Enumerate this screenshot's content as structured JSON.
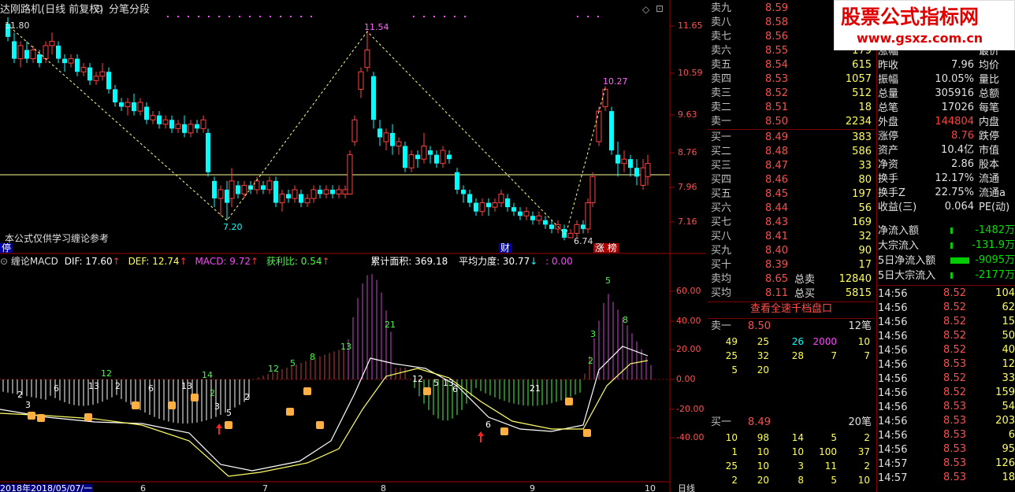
{
  "header": {
    "title": "达刚路机(日线 前复权)",
    "period_label": "分笔分段",
    "note": "本公式仅供学习缠论参考",
    "stop_tag": "停",
    "event_cai": "财",
    "event_zhangbang": "涨 榜"
  },
  "price_axis": [
    "11.65",
    "10.59",
    "9.63",
    "8.76",
    "7.96",
    "7.16"
  ],
  "price_marks": {
    "p1": "11.80",
    "p2": "11.54",
    "p3": "7.20",
    "p4": "10.27",
    "p5": "6.74"
  },
  "indicator": {
    "name": "缠论MACD",
    "dif_label": "DIF: 17.60",
    "def_label": "DEF: 12.74",
    "macd_label": "MACD: 9.72",
    "profit_label": "获利比: 0.54",
    "area_label": "累计面积: 369.18",
    "power_label": "平均力度: 30.77",
    "zero_label": ": 0.00",
    "axis": [
      "60.00",
      "40.00",
      "20.00",
      "0.00",
      "-20.00",
      "-40.00"
    ],
    "counts": [
      "2",
      "3",
      "6",
      "13",
      "12",
      "2",
      "6",
      "13",
      "14",
      "2",
      "3",
      "5",
      "2",
      "12",
      "5",
      "8",
      "13",
      "21",
      "12",
      "5",
      "6",
      "21",
      "6",
      "13",
      "3",
      "2",
      "5",
      "8"
    ]
  },
  "bottom_axis": {
    "date_label": "2018年2018/05/07/一",
    "months": [
      "6",
      "7",
      "8",
      "9",
      "10"
    ],
    "right_label": "日线"
  },
  "order_book": {
    "sells": [
      {
        "label": "卖九",
        "price": "8.59",
        "vol": ""
      },
      {
        "label": "卖八",
        "price": "8.58",
        "vol": ""
      },
      {
        "label": "卖七",
        "price": "8.56",
        "vol": ""
      },
      {
        "label": "卖六",
        "price": "8.55",
        "vol": "179"
      },
      {
        "label": "卖五",
        "price": "8.54",
        "vol": "615"
      },
      {
        "label": "卖四",
        "price": "8.53",
        "vol": "1057"
      },
      {
        "label": "卖三",
        "price": "8.52",
        "vol": "512"
      },
      {
        "label": "卖二",
        "price": "8.51",
        "vol": "18"
      },
      {
        "label": "卖一",
        "price": "8.50",
        "vol": "2234"
      }
    ],
    "buys": [
      {
        "label": "买一",
        "price": "8.49",
        "vol": "383"
      },
      {
        "label": "买二",
        "price": "8.48",
        "vol": "586"
      },
      {
        "label": "买三",
        "price": "8.47",
        "vol": "33"
      },
      {
        "label": "买四",
        "price": "8.46",
        "vol": "80"
      },
      {
        "label": "买五",
        "price": "8.45",
        "vol": "197"
      },
      {
        "label": "买六",
        "price": "8.44",
        "vol": "56"
      },
      {
        "label": "买七",
        "price": "8.43",
        "vol": "169"
      },
      {
        "label": "买八",
        "price": "8.41",
        "vol": "32"
      },
      {
        "label": "买九",
        "price": "8.40",
        "vol": "90"
      },
      {
        "label": "买十",
        "price": "8.39",
        "vol": "17"
      }
    ],
    "avg_sell": {
      "label": "卖均",
      "price": "8.65",
      "tag": "总卖",
      "vol": "12840"
    },
    "avg_buy": {
      "label": "买均",
      "price": "8.11",
      "tag": "总买",
      "vol": "5815"
    },
    "full_depth_button": "查看全速千档盘口"
  },
  "quote": [
    {
      "l": "涨幅",
      "v": "",
      "r": "最价"
    },
    {
      "l": "昨收",
      "v": "7.96",
      "r": "均价"
    },
    {
      "l": "振幅",
      "v": "10.05%",
      "r": "量比"
    },
    {
      "l": "总量",
      "v": "305916",
      "r": "总额"
    },
    {
      "l": "总笔",
      "v": "17026",
      "r": "每笔"
    },
    {
      "l": "外盘",
      "v": "144804",
      "r": "内盘"
    },
    {
      "l": "涨停",
      "v": "8.76",
      "r": "跌停"
    },
    {
      "l": "资产",
      "v": "10.4亿",
      "r": "市值"
    },
    {
      "l": "净资",
      "v": "2.86",
      "r": "股本"
    },
    {
      "l": "换手",
      "v": "12.17%",
      "r": "流通"
    },
    {
      "l": "换手Z",
      "v": "22.75%",
      "r": "流通a"
    },
    {
      "l": "收益(三)",
      "v": "0.064",
      "r": "PE(动)"
    }
  ],
  "flows": [
    {
      "l": "净流入额",
      "v": "-1482万"
    },
    {
      "l": "大宗流入",
      "v": "-131.9万"
    },
    {
      "l": "5日净流入额",
      "v": "-9095万"
    },
    {
      "l": "5日大宗流入",
      "v": "-2177万"
    }
  ],
  "queue": {
    "sell_label": "卖一",
    "sell_price": "8.50",
    "sell_count": "12笔",
    "sell_rows": [
      [
        "49",
        "25",
        "26",
        "2000",
        "10"
      ],
      [
        "25",
        "32",
        "28",
        "7",
        "7"
      ],
      [
        "5",
        "20",
        "",
        "",
        ""
      ]
    ],
    "buy_label": "买一",
    "buy_price": "8.49",
    "buy_count": "20笔",
    "buy_rows": [
      [
        "10",
        "98",
        "14",
        "5",
        "2"
      ],
      [
        "1",
        "10",
        "10",
        "100",
        "37"
      ],
      [
        "25",
        "10",
        "3",
        "11",
        "2"
      ],
      [
        "2",
        "20",
        "8",
        "5",
        "10"
      ]
    ]
  },
  "ticks": [
    {
      "t": "14:56",
      "p": "8.52",
      "v": "104"
    },
    {
      "t": "14:56",
      "p": "8.52",
      "v": "62"
    },
    {
      "t": "14:56",
      "p": "8.52",
      "v": "15"
    },
    {
      "t": "14:56",
      "p": "8.52",
      "v": "50"
    },
    {
      "t": "14:56",
      "p": "8.52",
      "v": "40"
    },
    {
      "t": "14:56",
      "p": "8.53",
      "v": "12"
    },
    {
      "t": "14:56",
      "p": "8.52",
      "v": "33"
    },
    {
      "t": "14:56",
      "p": "8.52",
      "v": "159"
    },
    {
      "t": "14:56",
      "p": "8.53",
      "v": "54"
    },
    {
      "t": "14:56",
      "p": "8.53",
      "v": "203"
    },
    {
      "t": "14:56",
      "p": "8.53",
      "v": "6"
    },
    {
      "t": "14:56",
      "p": "8.53",
      "v": "95"
    },
    {
      "t": "14:57",
      "p": "8.53",
      "v": "126"
    },
    {
      "t": "14:57",
      "p": "8.53",
      "v": "18"
    }
  ],
  "logo": {
    "line1": "股票公式指标网",
    "line2": "www.gsxz.com.cn"
  },
  "colors": {
    "up": "#ff4040",
    "down": "#00ffff",
    "bg": "#000000",
    "grid": "#800000",
    "dif": "#ffffff",
    "dea": "#ffff00",
    "hist_up": "#cc44cc",
    "hist_down": "#44ff44"
  }
}
